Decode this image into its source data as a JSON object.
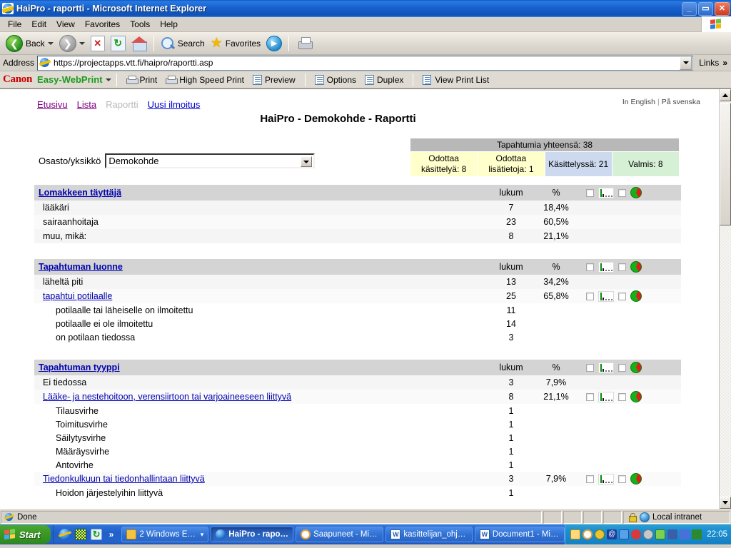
{
  "window": {
    "title": "HaiPro - raportti - Microsoft Internet Explorer",
    "minimize": "_",
    "restore": "▭",
    "close": "✕"
  },
  "menubar": {
    "items": [
      "File",
      "Edit",
      "View",
      "Favorites",
      "Tools",
      "Help"
    ]
  },
  "toolbar": {
    "back": "Back",
    "search": "Search",
    "favorites": "Favorites"
  },
  "address": {
    "label": "Address",
    "url": "https://projectapps.vtt.fi/haipro/raportti.asp",
    "links": "Links",
    "chevron": "»"
  },
  "canonbar": {
    "brand": "Canon",
    "product": "Easy-WebPrint",
    "caret": "▾",
    "buttons": [
      "Print",
      "High Speed Print",
      "Preview",
      "Options",
      "Duplex",
      "View Print List"
    ]
  },
  "page": {
    "nav": [
      {
        "label": "Etusivu",
        "state": "visited"
      },
      {
        "label": "Lista",
        "state": "visited"
      },
      {
        "label": "Raportti",
        "state": "current"
      },
      {
        "label": "Uusi ilmoitus",
        "state": "link"
      }
    ],
    "lang": {
      "english": "In English",
      "separator": "|",
      "swedish": "På svenska"
    },
    "title": "HaiPro - Demokohde - Raportti",
    "dept": {
      "label": "Osasto/yksikkö",
      "value": "Demokohde"
    },
    "summary": {
      "total": "Tapahtumia yhteensä: 38",
      "cells": [
        {
          "text": "Odottaa käsittelyä: 8",
          "color": "#ffffcc"
        },
        {
          "text": "Odottaa lisätietoja: 1",
          "color": "#ffffcc"
        },
        {
          "text": "Käsittelyssä: 21",
          "color": "#ccd9ee"
        },
        {
          "text": "Valmis: 8",
          "color": "#d6f0d6"
        }
      ]
    },
    "columns": {
      "count": "lukum",
      "percent": "%"
    },
    "sections": [
      {
        "title": "Lomakkeen täyttäjä",
        "show_columns": true,
        "show_icons": true,
        "rows": [
          {
            "label": "lääkäri",
            "count": "7",
            "percent": "18,4%",
            "indent": 1,
            "link": false,
            "icons": false
          },
          {
            "label": "sairaanhoitaja",
            "count": "23",
            "percent": "60,5%",
            "indent": 1,
            "link": false,
            "icons": false
          },
          {
            "label": "muu, mikä:",
            "count": "8",
            "percent": "21,1%",
            "indent": 1,
            "link": false,
            "icons": false
          }
        ]
      },
      {
        "title": "Tapahtuman luonne",
        "show_columns": true,
        "show_icons": true,
        "rows": [
          {
            "label": "läheltä piti",
            "count": "13",
            "percent": "34,2%",
            "indent": 1,
            "link": false,
            "icons": false
          },
          {
            "label": "tapahtui potilaalle",
            "count": "25",
            "percent": "65,8%",
            "indent": 1,
            "link": true,
            "icons": true
          },
          {
            "label": "potilaalle tai läheiselle on ilmoitettu",
            "count": "11",
            "percent": "",
            "indent": 2,
            "link": false,
            "icons": false
          },
          {
            "label": "potilaalle ei ole ilmoitettu",
            "count": "14",
            "percent": "",
            "indent": 2,
            "link": false,
            "icons": false
          },
          {
            "label": "on potilaan tiedossa",
            "count": "3",
            "percent": "",
            "indent": 2,
            "link": false,
            "icons": false
          }
        ]
      },
      {
        "title": "Tapahtuman tyyppi",
        "show_columns": true,
        "show_icons": true,
        "rows": [
          {
            "label": "Ei tiedossa",
            "count": "3",
            "percent": "7,9%",
            "indent": 1,
            "link": false,
            "icons": false
          },
          {
            "label": "Lääke- ja nestehoitoon, verensiirtoon tai varjoaineeseen liittyvä",
            "count": "8",
            "percent": "21,1%",
            "indent": 1,
            "link": true,
            "icons": true
          },
          {
            "label": "Tilausvirhe",
            "count": "1",
            "percent": "",
            "indent": 2,
            "link": false,
            "icons": false
          },
          {
            "label": "Toimitusvirhe",
            "count": "1",
            "percent": "",
            "indent": 2,
            "link": false,
            "icons": false
          },
          {
            "label": "Säilytysvirhe",
            "count": "1",
            "percent": "",
            "indent": 2,
            "link": false,
            "icons": false
          },
          {
            "label": "Määräysvirhe",
            "count": "1",
            "percent": "",
            "indent": 2,
            "link": false,
            "icons": false
          },
          {
            "label": "Antovirhe",
            "count": "1",
            "percent": "",
            "indent": 2,
            "link": false,
            "icons": false
          },
          {
            "label": "Tiedonkulkuun tai tiedonhallintaan liittyvä",
            "count": "3",
            "percent": "7,9%",
            "indent": 1,
            "link": true,
            "icons": true
          },
          {
            "label": "Hoidon järjestelyihin liittyvä",
            "count": "1",
            "percent": "",
            "indent": 2,
            "link": false,
            "icons": false
          }
        ]
      }
    ]
  },
  "statusbar": {
    "text": "Done",
    "zone": "Local intranet"
  },
  "taskbar": {
    "start": "Start",
    "quicklaunch_chevron": "»",
    "tasks": [
      {
        "label": "2 Windows Ex...",
        "icon": "folder",
        "active": false,
        "dropdown": true
      },
      {
        "label": "HaiPro - rapor...",
        "icon": "ie",
        "active": true,
        "dropdown": false
      },
      {
        "label": "Saapuneet - Mic...",
        "icon": "clock",
        "active": false,
        "dropdown": false
      },
      {
        "label": "kasittelijan_ohje...",
        "icon": "word",
        "active": false,
        "dropdown": false
      },
      {
        "label": "Document1 - Mic...",
        "icon": "word",
        "active": false,
        "dropdown": false
      }
    ],
    "clock": "22:05"
  },
  "colors": {
    "accent_blue": "#0000b0",
    "header_gray": "#d4d4d4",
    "total_gray": "#b8b8b8",
    "pie_green": "#17b017",
    "pie_red": "#e01b1b"
  }
}
